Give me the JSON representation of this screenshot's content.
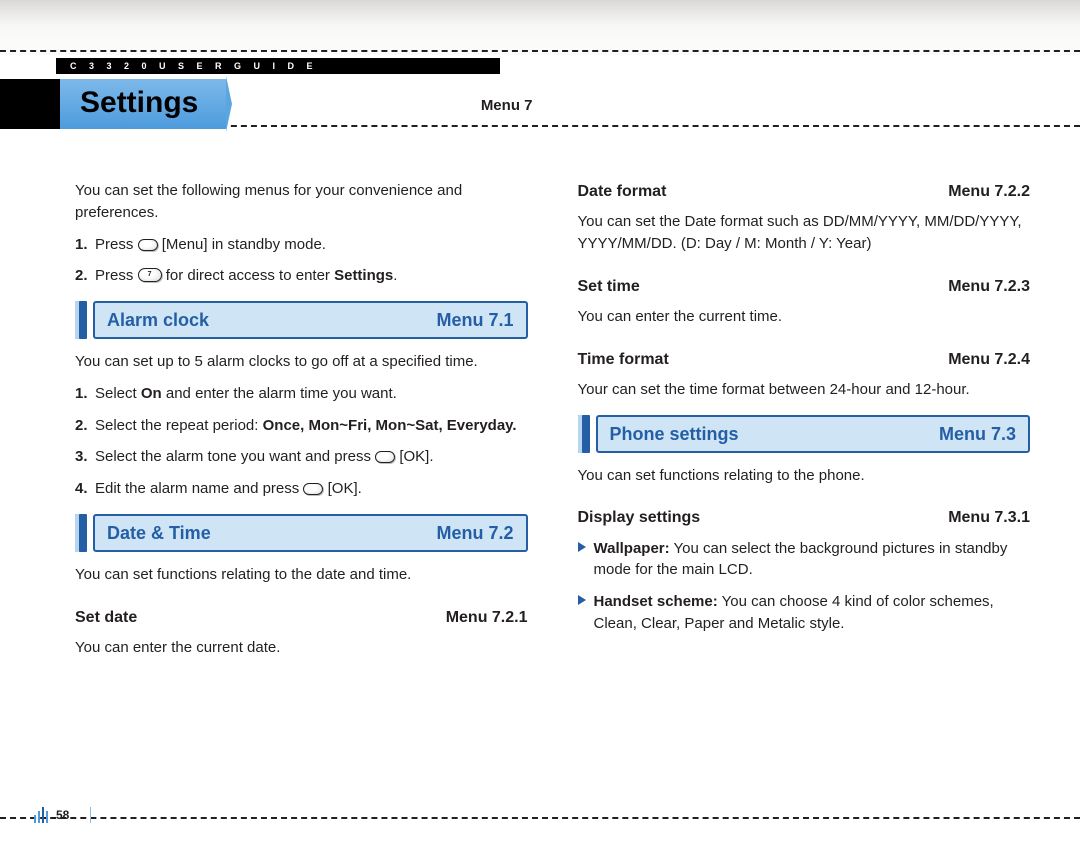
{
  "header": {
    "strip": "C 3 3 2 0   U S E R   G U I D E",
    "title": "Settings",
    "menu_no": "Menu 7"
  },
  "left": {
    "intro": "You can set the following menus for your convenience and preferences.",
    "steps_intro": [
      {
        "n": "1.",
        "pre": "Press ",
        "post": " [Menu] in standby mode."
      },
      {
        "n": "2.",
        "pre": "Press ",
        "mid": " for direct access to enter ",
        "bold": "Settings",
        "end": "."
      }
    ],
    "sec1": {
      "title": "Alarm clock",
      "menu": "Menu 7.1"
    },
    "sec1_desc": "You can set up to 5 alarm clocks to go off at a specified time.",
    "sec1_steps": [
      {
        "n": "1.",
        "pre": "Select ",
        "b1": "On",
        "post": " and enter the alarm time you want."
      },
      {
        "n": "2.",
        "pre": "Select the repeat period: ",
        "b1": "Once, Mon~Fri, Mon~Sat, Everyday.",
        "post": ""
      },
      {
        "n": "3.",
        "pre": "Select the alarm tone you want and press ",
        "post": " [OK]."
      },
      {
        "n": "4.",
        "pre": "Edit the alarm name and press ",
        "post": " [OK]."
      }
    ],
    "sec2": {
      "title": "Date & Time",
      "menu": "Menu 7.2"
    },
    "sec2_desc": "You can set functions relating to the date and time.",
    "sub1": {
      "title": "Set date",
      "menu": "Menu 7.2.1",
      "desc": "You can enter the current date."
    }
  },
  "right": {
    "sub2": {
      "title": "Date format",
      "menu": "Menu 7.2.2",
      "desc": "You can set the Date format such as DD/MM/YYYY, MM/DD/YYYY, YYYY/MM/DD. (D: Day / M: Month / Y: Year)"
    },
    "sub3": {
      "title": "Set time",
      "menu": "Menu 7.2.3",
      "desc": "You can enter the current time."
    },
    "sub4": {
      "title": "Time format",
      "menu": "Menu 7.2.4",
      "desc": "Your can set the time format between 24-hour and 12-hour."
    },
    "sec3": {
      "title": "Phone settings",
      "menu": "Menu 7.3",
      "desc": "You can set functions relating to the phone."
    },
    "sub5": {
      "title": "Display settings",
      "menu": "Menu 7.3.1"
    },
    "bullets": [
      {
        "lead": "Wallpaper:",
        "text": " You can select the background pictures in standby mode for the main LCD."
      },
      {
        "lead": "Handset scheme:",
        "text": " You can choose 4 kind of color schemes, Clean, Clear, Paper and Metalic style."
      }
    ]
  },
  "key7": "7",
  "page_no": "58"
}
